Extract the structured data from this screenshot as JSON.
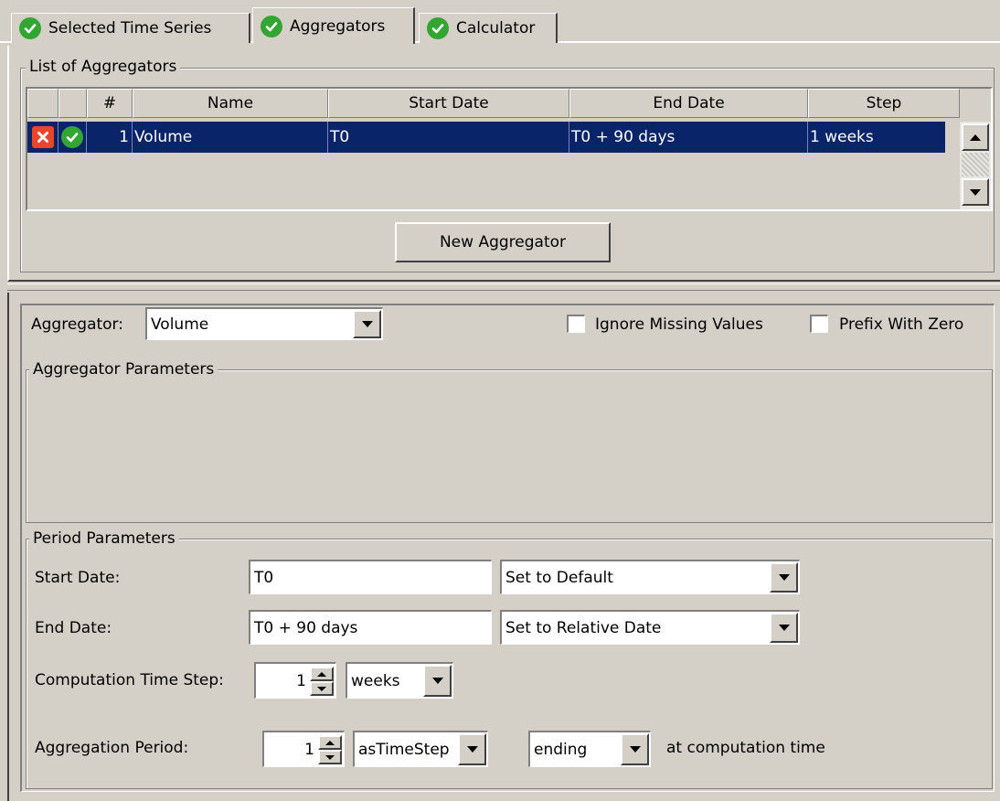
{
  "tabs": [
    {
      "label": "Selected Time Series",
      "icon": "check-icon"
    },
    {
      "label": "Aggregators",
      "icon": "check-icon",
      "active": true
    },
    {
      "label": "Calculator",
      "icon": "check-icon"
    }
  ],
  "list_group": {
    "title": "List of Aggregators",
    "columns": [
      "",
      "",
      "#",
      "Name",
      "Start Date",
      "End Date",
      "Step"
    ],
    "rows": [
      {
        "num": "1",
        "name": "Volume",
        "start": "T0",
        "end": "T0 + 90 days",
        "step": "1 weeks",
        "delete_icon": "delete-icon",
        "ok_icon": "check-icon"
      }
    ],
    "new_button": "New Aggregator"
  },
  "aggregator": {
    "label": "Aggregator:",
    "value": "Volume",
    "ignore_missing": {
      "label": "Ignore Missing Values",
      "checked": false
    },
    "prefix_zero": {
      "label": "Prefix With Zero",
      "checked": false
    }
  },
  "params_group": {
    "title": "Aggregator Parameters"
  },
  "period": {
    "title": "Period Parameters",
    "start_label": "Start Date:",
    "start_value": "T0",
    "start_mode": "Set to Default",
    "end_label": "End Date:",
    "end_value": "T0 + 90 days",
    "end_mode": "Set to Relative Date",
    "step_label": "Computation Time Step:",
    "step_value": "1",
    "step_unit": "weeks",
    "agg_label": "Aggregation Period:",
    "agg_value": "1",
    "agg_unit": "asTimeStep",
    "agg_anchor": "ending",
    "agg_suffix": "at computation time"
  },
  "colors": {
    "selection": "#0a246a",
    "check_green": "#33a532",
    "delete_red": "#e8452c",
    "face": "#d4d0c8"
  }
}
